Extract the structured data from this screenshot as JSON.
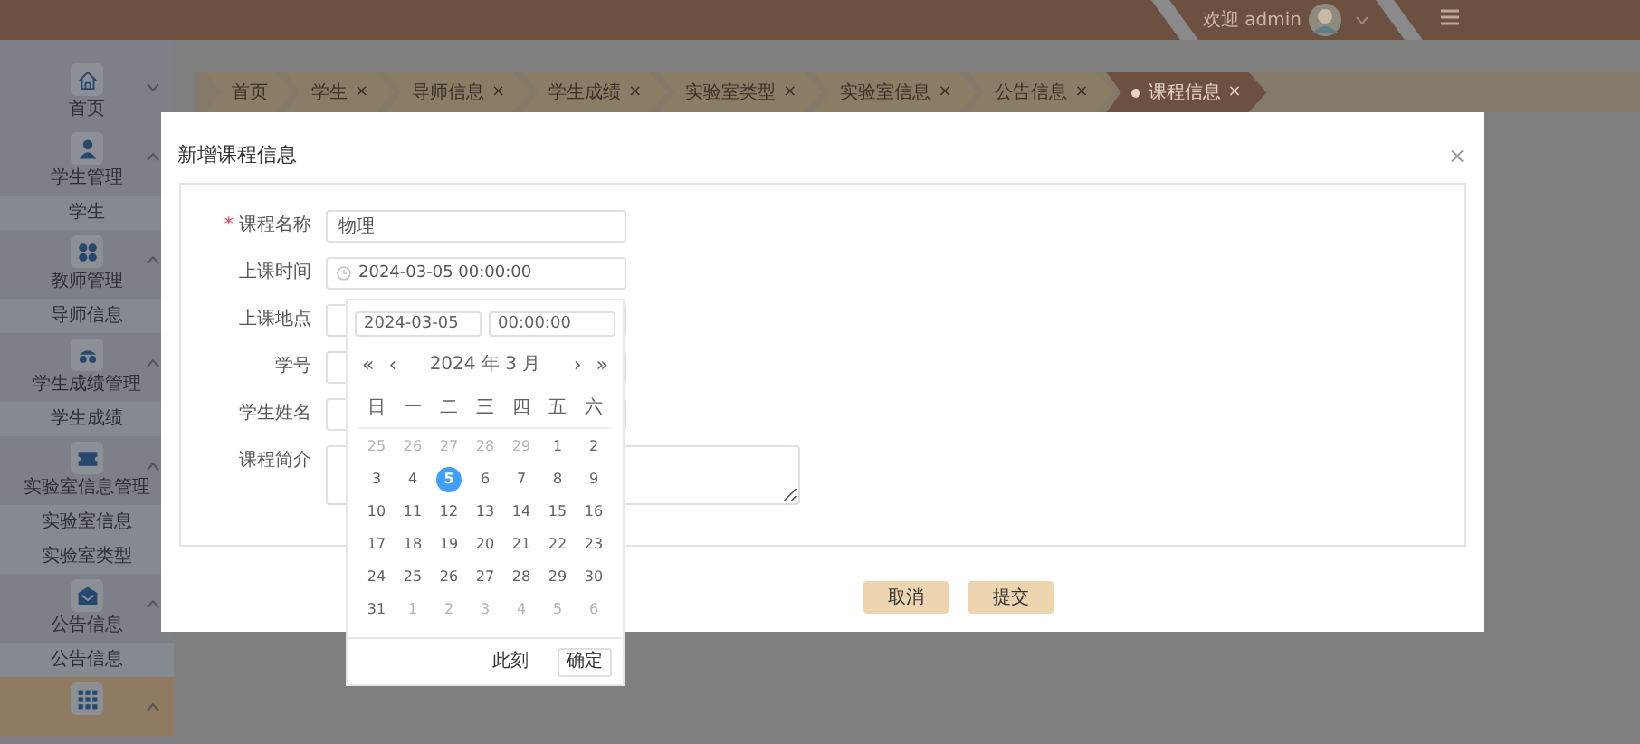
{
  "header": {
    "welcome": "欢迎 admin"
  },
  "sidebar": {
    "items": [
      {
        "label": "首页",
        "expanded": false,
        "selected": false
      },
      {
        "label": "学生管理",
        "expanded": true,
        "selected": false,
        "children": [
          {
            "label": "学生"
          }
        ]
      },
      {
        "label": "教师管理",
        "expanded": true,
        "selected": false,
        "children": [
          {
            "label": "导师信息"
          }
        ]
      },
      {
        "label": "学生成绩管理",
        "expanded": true,
        "selected": false,
        "children": [
          {
            "label": "学生成绩"
          }
        ]
      },
      {
        "label": "实验室信息管理",
        "expanded": true,
        "selected": false,
        "children": [
          {
            "label": "实验室信息"
          },
          {
            "label": "实验室类型"
          }
        ]
      },
      {
        "label": "公告信息",
        "expanded": true,
        "selected": false,
        "children": [
          {
            "label": "公告信息"
          }
        ]
      },
      {
        "expanded": true,
        "selected": true
      }
    ]
  },
  "tabs": [
    {
      "label": "首页",
      "selected": false
    },
    {
      "label": "学生",
      "close": "×",
      "selected": false
    },
    {
      "label": "导师信息",
      "close": "×",
      "selected": false
    },
    {
      "label": "学生成绩",
      "close": "×",
      "selected": false
    },
    {
      "label": "实验室类型",
      "close": "×",
      "selected": false
    },
    {
      "label": "实验室信息",
      "close": "×",
      "selected": false
    },
    {
      "label": "公告信息",
      "close": "×",
      "selected": false
    },
    {
      "label": "课程信息",
      "close": "×",
      "selected": true
    }
  ],
  "dialog": {
    "title": "新增课程信息",
    "close": "×",
    "fields": [
      {
        "label": "课程名称",
        "required_mark": "*",
        "kind": "text",
        "value": "物理"
      },
      {
        "label": "上课时间",
        "kind": "datetime",
        "value": "2024-03-05 00:00:00"
      },
      {
        "label": "上课地点",
        "kind": "text"
      },
      {
        "label": "学号",
        "kind": "text"
      },
      {
        "label": "学生姓名",
        "kind": "text"
      },
      {
        "label": "课程简介",
        "kind": "textarea"
      }
    ],
    "buttons": [
      {
        "label": "取消"
      },
      {
        "label": "提交"
      }
    ]
  },
  "date_picker": {
    "date": "2024-03-05",
    "time": "00:00:00",
    "prev_year": "«",
    "prev_month": "‹",
    "title": "2024 年 3 月",
    "next_month": "›",
    "next_year": "»",
    "weekdays": [
      "日",
      "一",
      "二",
      "三",
      "四",
      "五",
      "六"
    ],
    "days": [
      {
        "label": "25",
        "current_month": false,
        "selected": false
      },
      {
        "label": "26",
        "current_month": false,
        "selected": false
      },
      {
        "label": "27",
        "current_month": false,
        "selected": false
      },
      {
        "label": "28",
        "current_month": false,
        "selected": false
      },
      {
        "label": "29",
        "current_month": false,
        "selected": false
      },
      {
        "label": "1",
        "current_month": true,
        "selected": false
      },
      {
        "label": "2",
        "current_month": true,
        "selected": false
      },
      {
        "label": "3",
        "current_month": true,
        "selected": false
      },
      {
        "label": "4",
        "current_month": true,
        "selected": false
      },
      {
        "label": "5",
        "current_month": true,
        "selected": true
      },
      {
        "label": "6",
        "current_month": true,
        "selected": false
      },
      {
        "label": "7",
        "current_month": true,
        "selected": false
      },
      {
        "label": "8",
        "current_month": true,
        "selected": false
      },
      {
        "label": "9",
        "current_month": true,
        "selected": false
      },
      {
        "label": "10",
        "current_month": true,
        "selected": false
      },
      {
        "label": "11",
        "current_month": true,
        "selected": false
      },
      {
        "label": "12",
        "current_month": true,
        "selected": false
      },
      {
        "label": "13",
        "current_month": true,
        "selected": false
      },
      {
        "label": "14",
        "current_month": true,
        "selected": false
      },
      {
        "label": "15",
        "current_month": true,
        "selected": false
      },
      {
        "label": "16",
        "current_month": true,
        "selected": false
      },
      {
        "label": "17",
        "current_month": true,
        "selected": false
      },
      {
        "label": "18",
        "current_month": true,
        "selected": false
      },
      {
        "label": "19",
        "current_month": true,
        "selected": false
      },
      {
        "label": "20",
        "current_month": true,
        "selected": false
      },
      {
        "label": "21",
        "current_month": true,
        "selected": false
      },
      {
        "label": "22",
        "current_month": true,
        "selected": false
      },
      {
        "label": "23",
        "current_month": true,
        "selected": false
      },
      {
        "label": "24",
        "current_month": true,
        "selected": false
      },
      {
        "label": "25",
        "current_month": true,
        "selected": false
      },
      {
        "label": "26",
        "current_month": true,
        "selected": false
      },
      {
        "label": "27",
        "current_month": true,
        "selected": false
      },
      {
        "label": "28",
        "current_month": true,
        "selected": false
      },
      {
        "label": "29",
        "current_month": true,
        "selected": false
      },
      {
        "label": "30",
        "current_month": true,
        "selected": false
      },
      {
        "label": "31",
        "current_month": true,
        "selected": false
      },
      {
        "label": "1",
        "current_month": false,
        "selected": false
      },
      {
        "label": "2",
        "current_month": false,
        "selected": false
      },
      {
        "label": "3",
        "current_month": false,
        "selected": false
      },
      {
        "label": "4",
        "current_month": false,
        "selected": false
      },
      {
        "label": "5",
        "current_month": false,
        "selected": false
      },
      {
        "label": "6",
        "current_month": false,
        "selected": false
      }
    ],
    "now": "此刻",
    "ok": "确定"
  }
}
